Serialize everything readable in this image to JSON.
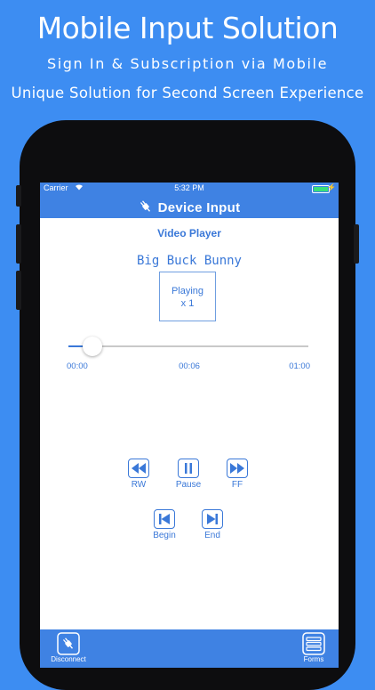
{
  "promo": {
    "title": "Mobile Input Solution",
    "subtitle1": "Sign In & Subscription via Mobile",
    "subtitle2": "Unique Solution for Second Screen Experience"
  },
  "status_bar": {
    "carrier": "Carrier",
    "time": "5:32 PM"
  },
  "nav": {
    "title": "Device Input"
  },
  "player": {
    "section_title": "Video Player",
    "video_title": "Big Buck Bunny",
    "state_line1": "Playing",
    "state_line2": "x 1",
    "progress_fraction": 0.1,
    "time_start": "00:00",
    "time_current": "00:06",
    "time_end": "01:00"
  },
  "controls": {
    "rw": "RW",
    "pause": "Pause",
    "ff": "FF",
    "begin": "Begin",
    "end": "End"
  },
  "tabbar": {
    "disconnect": "Disconnect",
    "forms": "Forms"
  },
  "colors": {
    "background": "#3d8df2",
    "bar": "#3f82e3",
    "accent": "#3a78d8"
  }
}
